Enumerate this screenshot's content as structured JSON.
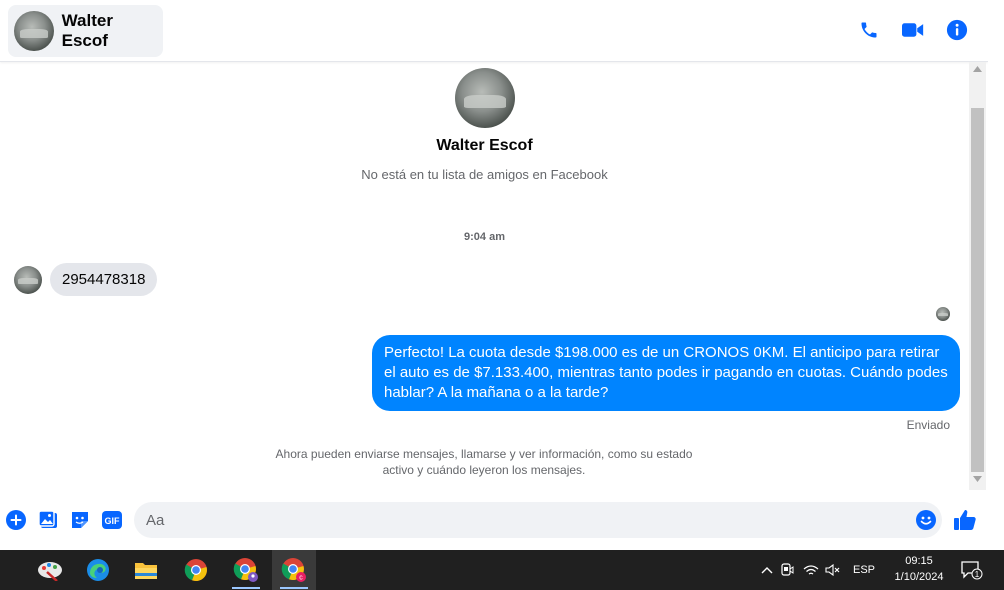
{
  "header": {
    "contact_name": "Walter Escof",
    "actions": [
      {
        "icon": "phone-icon"
      },
      {
        "icon": "video-camera-icon"
      },
      {
        "icon": "info-icon"
      }
    ]
  },
  "profile": {
    "name": "Walter Escof",
    "subtitle": "No está en tu lista de amigos en Facebook"
  },
  "conversation": {
    "timestamp": "9:04 am",
    "incoming": [
      {
        "text": "2954478318"
      }
    ],
    "outgoing": [
      {
        "text": "Perfecto! La cuota desde $198.000 es de un CRONOS 0KM. El anticipo para retirar el auto es de $7.133.400, mientras tanto podes ir pagando en cuotas. Cuándo podes hablar? A la mañana o a la tarde?"
      }
    ],
    "status": "Enviado",
    "notice": "Ahora pueden enviarse mensajes, llamarse y ver información, como su estado activo y cuándo leyeron los mensajes."
  },
  "composer": {
    "placeholder": "Aa",
    "icons": [
      "add-icon",
      "photo-icon",
      "sticker-icon",
      "gif-icon",
      "emoji-icon",
      "like-icon"
    ],
    "gif_label": "GIF"
  },
  "colors": {
    "accent": "#0084ff",
    "icon_blue": "#0866ff",
    "bubble_in": "#e4e6eb",
    "taskbar": "#202020"
  },
  "taskbar": {
    "apps": [
      "paint-icon",
      "edge-icon",
      "file-explorer-icon",
      "chrome-icon",
      "chrome-profile-icon",
      "chrome-profile-c-icon"
    ],
    "language": "ESP",
    "time": "09:15",
    "date": "1/10/2024",
    "notification_count": "1"
  }
}
